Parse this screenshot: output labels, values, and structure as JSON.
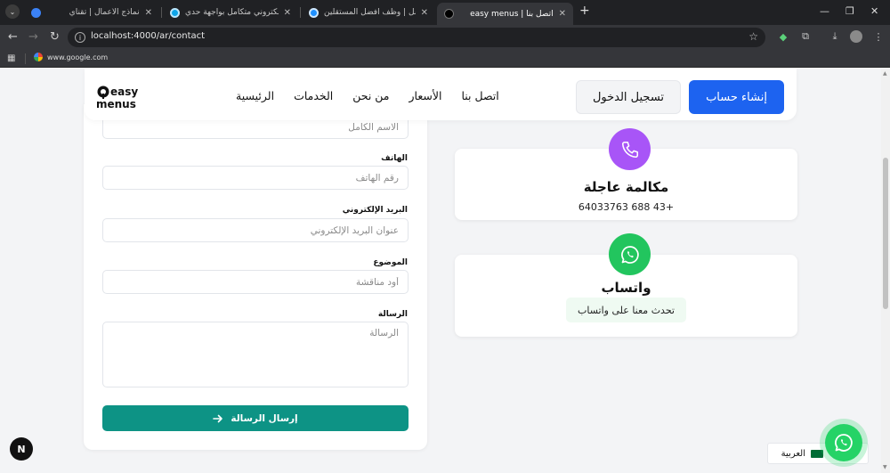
{
  "browser": {
    "tabs": [
      {
        "title": "نماذج الأعمال | تقنأي",
        "active": false
      },
      {
        "title": "متجر إلكتروني متكامل بواجهة حدي",
        "active": false
      },
      {
        "title": "مستقل | وظف أفضل المستقلين",
        "active": false
      },
      {
        "title": "easy menus | اتصل بنا",
        "active": true
      }
    ],
    "new_tab": "+",
    "url": "localhost:4000/ar/contact",
    "bookmark": "www.google.com"
  },
  "header": {
    "logo_top": "easy",
    "logo_bottom": "menus",
    "nav": [
      "الرئيسية",
      "الخدمات",
      "من نحن",
      "الأسعار",
      "اتصل بنا"
    ],
    "login": "تسجيل الدخول",
    "signup": "إنشاء حساب"
  },
  "form": {
    "name_placeholder": "الاسم الكامل",
    "phone_label": "الهاتف",
    "phone_placeholder": "رقم الهاتف",
    "email_label": "البريد الإلكتروني",
    "email_placeholder": "عنوان البريد الإلكتروني",
    "subject_label": "الموضوع",
    "subject_placeholder": "أود مناقشة",
    "message_label": "الرسالة",
    "message_placeholder": "الرسالة",
    "submit": "إرسال الرسالة"
  },
  "cards": {
    "call_title": "مكالمة عاجلة",
    "call_number": "+43 688 64033763",
    "whatsapp_title": "واتساب",
    "whatsapp_cta": "تحدث معنا على واتساب"
  },
  "footer": {
    "next_badge": "N",
    "language": "العربية"
  },
  "colors": {
    "primary": "#1d63f0",
    "send": "#0d9385",
    "call_icon_bg": "#a855f7",
    "whatsapp": "#25d366"
  }
}
